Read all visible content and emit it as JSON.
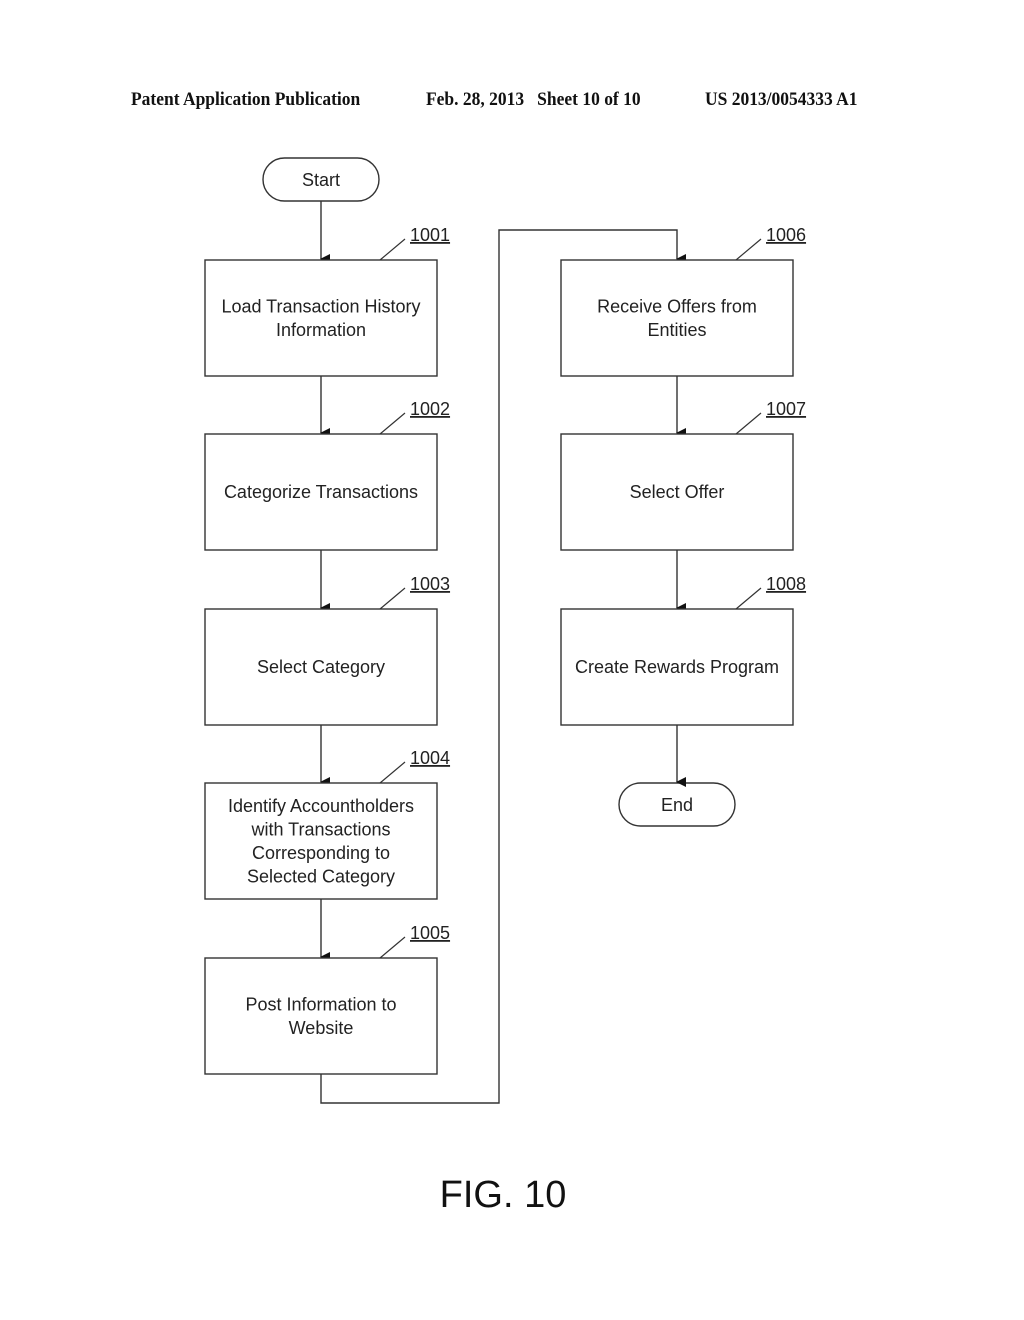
{
  "header": {
    "publication": "Patent Application Publication",
    "date_sheet": "Feb. 28, 2013   Sheet 10 of 10",
    "number": "US 2013/0054333 A1"
  },
  "flowchart": {
    "start_label": "Start",
    "end_label": "End",
    "steps": [
      {
        "ref": "1001",
        "lines": [
          "Load Transaction History",
          "Information"
        ]
      },
      {
        "ref": "1002",
        "lines": [
          "Categorize Transactions"
        ]
      },
      {
        "ref": "1003",
        "lines": [
          "Select Category"
        ]
      },
      {
        "ref": "1004",
        "lines": [
          "Identify Accountholders",
          "with Transactions",
          "Corresponding to",
          "Selected Category"
        ]
      },
      {
        "ref": "1005",
        "lines": [
          "Post Information to",
          "Website"
        ]
      },
      {
        "ref": "1006",
        "lines": [
          "Receive Offers from",
          "Entities"
        ]
      },
      {
        "ref": "1007",
        "lines": [
          "Select Offer"
        ]
      },
      {
        "ref": "1008",
        "lines": [
          "Create Rewards Program"
        ]
      }
    ],
    "figure_label": "FIG. 10"
  }
}
